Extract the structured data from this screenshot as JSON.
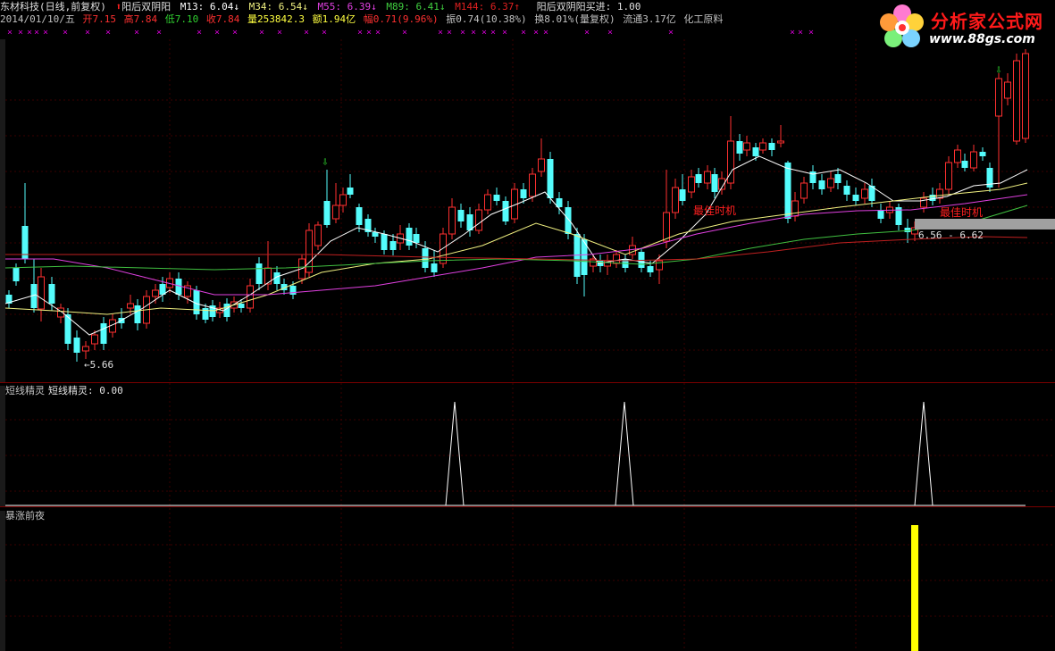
{
  "header": {
    "stock": "东材科技(日线,前复权)",
    "indicator_name": "阳后双阴阳",
    "m13": "M13: 6.04↓",
    "m34": "M34: 6.54↓",
    "m55": "M55: 6.39↓",
    "m89": "M89: 6.41↓",
    "m144": "M144: 6.37↑",
    "signal": "阳后双阴阳买进: 1.00"
  },
  "quote": {
    "date": "2014/01/10/五",
    "open": "开7.15",
    "high": "高7.84",
    "low": "低7.10",
    "close": "收7.84",
    "volume": "量253842.3",
    "amount": "额1.94亿",
    "change": "幅0.71(9.96%)",
    "amplitude": "振0.74(10.38%)",
    "turnover": "换8.01%(量复权)",
    "float": "流通3.17亿",
    "industry": "化工原料"
  },
  "logo": {
    "title": "分析家公式网",
    "url": "www.88gs.com"
  },
  "annotations": {
    "low_marker": "←5.66",
    "best_time_1": "最佳时机",
    "best_time_2": "最佳时机",
    "range_label": "6.56 - 6.62"
  },
  "panel2": {
    "title": "短线精灵",
    "value": "短线精灵: 0.00"
  },
  "panel3": {
    "title": "暴涨前夜"
  },
  "colors": {
    "up": "#ff3030",
    "down": "#54fcfc",
    "m13": "#ffffff",
    "m34": "#f0f080",
    "m55": "#e040e0",
    "m89": "#40c040",
    "m144": "#c02020",
    "signal": "#ffff00"
  },
  "icons": [
    "up-arrow-icon",
    "down-arrow-icon",
    "flower-logo-icon"
  ]
}
